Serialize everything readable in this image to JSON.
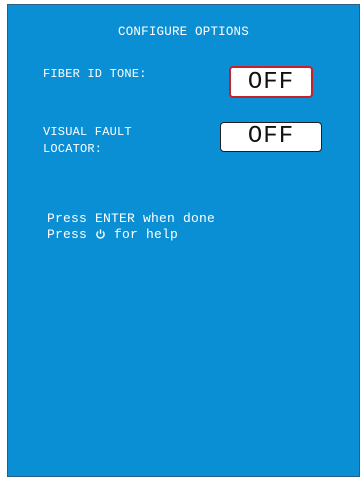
{
  "screen": {
    "title": "CONFIGURE OPTIONS",
    "options": [
      {
        "label_lines": [
          "FIBER ID TONE:"
        ],
        "value": "OFF",
        "selected": true
      },
      {
        "label_lines": [
          "VISUAL FAULT",
          "LOCATOR:"
        ],
        "value": "OFF",
        "selected": false
      }
    ],
    "help": {
      "line1": "Press ENTER when done",
      "line2_prefix": "Press ",
      "line2_icon": "power-icon",
      "line2_suffix": " for help"
    }
  },
  "colors": {
    "background": "#0a8fd4",
    "selected_border": "#c8202a"
  }
}
